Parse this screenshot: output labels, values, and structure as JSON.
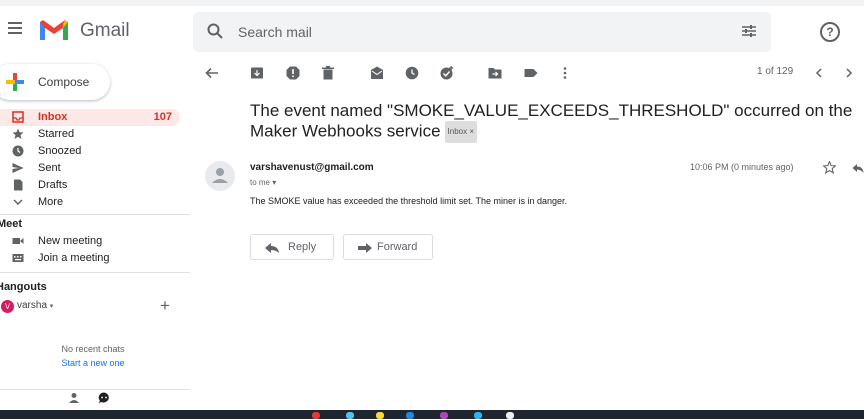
{
  "app": {
    "brand": "Gmail"
  },
  "search": {
    "placeholder": "Search mail"
  },
  "help": {
    "symbol": "?"
  },
  "compose": {
    "label": "Compose"
  },
  "sidebar": {
    "items": [
      {
        "label": "Inbox",
        "count": "107",
        "icon": "inbox-icon"
      },
      {
        "label": "Starred",
        "icon": "star-icon"
      },
      {
        "label": "Snoozed",
        "icon": "clock-icon"
      },
      {
        "label": "Sent",
        "icon": "send-icon"
      },
      {
        "label": "Drafts",
        "icon": "draft-icon"
      },
      {
        "label": "More",
        "icon": "chevron-down-icon"
      }
    ],
    "meet": {
      "title": "Meet",
      "items": [
        {
          "label": "New meeting",
          "icon": "video-icon"
        },
        {
          "label": "Join a meeting",
          "icon": "keyboard-icon"
        }
      ]
    },
    "hangouts": {
      "title": "Hangouts",
      "user_initial": "V",
      "user": "varsha",
      "no_chats": "No recent chats",
      "start_new": "Start a new one"
    }
  },
  "toolbar": {
    "page_count": "1 of 129"
  },
  "email": {
    "subject": "The event named \"SMOKE_VALUE_EXCEEDS_THRESHOLD\" occurred on the Maker Webhooks service",
    "label_badge": "Inbox ×",
    "sender": "varshavenust@gmail.com",
    "to": "to me ▾",
    "time": "10:06 PM (0 minutes ago)",
    "body": "The SMOKE value has exceeded the threshold limit set. The miner is in danger.",
    "reply_label": "Reply",
    "forward_label": "Forward"
  },
  "colors": {
    "accent_red": "#d93025",
    "active_bg": "#fce8e6",
    "link_blue": "#1a73e8",
    "text_gray": "#5f6368"
  }
}
